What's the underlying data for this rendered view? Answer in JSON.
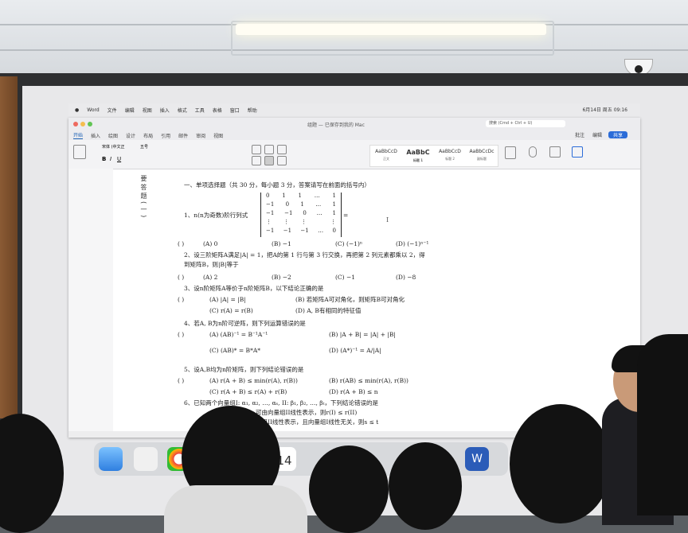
{
  "menubar": {
    "items": [
      "Word",
      "文件",
      "编辑",
      "视图",
      "插入",
      "格式",
      "工具",
      "表格",
      "窗口",
      "帮助"
    ],
    "clock": "6月14日 周五 09:16"
  },
  "window": {
    "title": "组题 — 已保存到我的 Mac",
    "search_placeholder": "搜索 (Cmd + Ctrl + U)",
    "tabs": [
      "开始",
      "插入",
      "绘图",
      "设计",
      "布局",
      "引用",
      "邮件",
      "审阅",
      "视图"
    ],
    "share_label": "共享",
    "comments_label": "批注",
    "editing_label": "编辑",
    "styles": [
      {
        "sample": "AaBbCcD",
        "name": "正文"
      },
      {
        "sample": "AaBbC",
        "name": "标题 1"
      },
      {
        "sample": "AaBbCcD",
        "name": "标题 2"
      },
      {
        "sample": "AaBbCcDc",
        "name": "副标题"
      }
    ],
    "font_name": "宋体 (中文正",
    "font_size": "五号"
  },
  "side_label": "要答题(一)",
  "exam": {
    "section_heading": "一、单项选择题（共 30 分，每小题 3 分，答案请写在前面的括号内）",
    "q1": "1、n(n为奇数)阶行列式",
    "q1_matrix": [
      [
        "0",
        "1",
        "1",
        "…",
        "1"
      ],
      [
        "−1",
        "0",
        "1",
        "…",
        "1"
      ],
      [
        "−1",
        "−1",
        "0",
        "…",
        "1"
      ],
      [
        "⋮",
        "⋮",
        "⋮",
        "",
        "⋮"
      ],
      [
        "−1",
        "−1",
        "−1",
        "…",
        "0"
      ]
    ],
    "q1_tail": "=",
    "q1_options": [
      "(A) 0",
      "(B) −1",
      "(C) (−1)ⁿ",
      "(D) (−1)ⁿ⁻¹"
    ],
    "q2_line1": "2、设三阶矩阵A满足|A| = 1，把A的第 1 行与第 3 行交换，再把第 2 列元素都乘以 2，得",
    "q2_line2": "到矩阵B，则|B|等于",
    "q2_options": [
      "(A) 2",
      "(B) −2",
      "(C) −1",
      "(D) −8"
    ],
    "q3": "3、设n阶矩阵A等价于n阶矩阵B，以下结论正确的是",
    "q3_options": [
      "(A) |A| = |B|",
      "(B) 若矩阵A可对角化，则矩阵B可对角化",
      "(C) r(A) = r(B)",
      "(D) A, B有相同的特征值"
    ],
    "q4": "4、若A, B为n阶可逆阵，则下列运算错误的是",
    "q4_options": [
      "(A) (AB)⁻¹ = B⁻¹A⁻¹",
      "(B) |A + B| = |A| + |B|",
      "(C) (AB)* = B*A*",
      "(D) (A*)⁻¹ = A/|A|"
    ],
    "q5": "5、设A,B均为n阶矩阵，则下列结论错误的是",
    "q5_options": [
      "(A) r(A + B) ≤ min(r(A), r(B))",
      "(B) r(AB) ≤ min(r(A), r(B))",
      "(C) r(A + B) ≤ r(A) + r(B)",
      "(D) r(A + B) ≤ n"
    ],
    "q6_line1": "6、已知两个向量组I: α₁, α₂, …, αₛ, II: β₁, β₂, …, βₜ，下列结论错误的是",
    "q6_line2": "可由向量组II线性表示，则r(I) ≤ r(II)",
    "q6_line3": "量组II线性表示，且向量组I线性无关，则s ≤ t",
    "answer_bracket": "(    )"
  },
  "dock": {
    "calendar_day": "14",
    "word_letter": "W"
  }
}
